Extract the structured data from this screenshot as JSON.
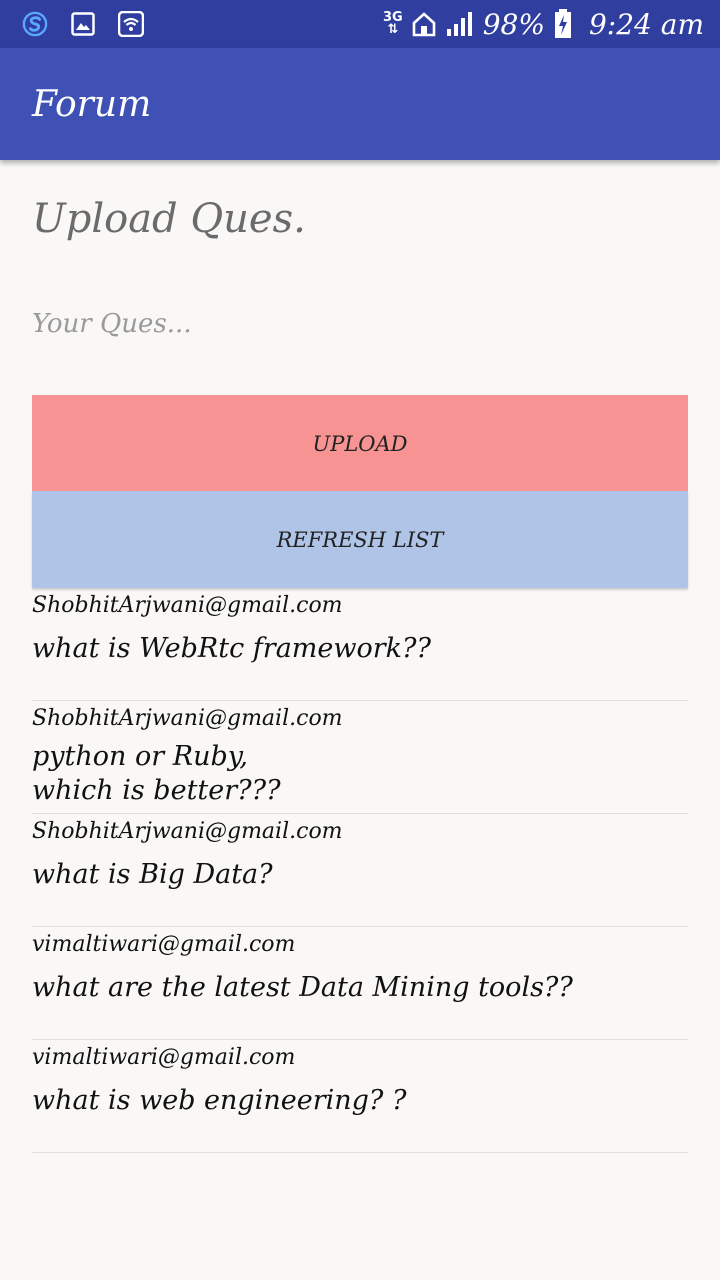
{
  "status_bar": {
    "icons": [
      "s-app-icon",
      "image-icon",
      "wifi-icon",
      "home-icon",
      "signal-icon",
      "battery-charging-icon"
    ],
    "network_top": "3G",
    "network_bottom": "⇅",
    "battery": "98%",
    "time": "9:24 am"
  },
  "app_bar": {
    "title": "Forum"
  },
  "upload": {
    "title": "Upload Ques.",
    "placeholder": "Your Ques...",
    "upload_label": "UPLOAD",
    "refresh_label": "REFRESH LIST"
  },
  "colors": {
    "status_bar": "#303f9f",
    "app_bar": "#3f51b5",
    "upload_button": "#f79392",
    "refresh_button": "#b0c4e8"
  },
  "questions": [
    {
      "email": "ShobhitArjwani@gmail.com",
      "question": "what is WebRtc framework??"
    },
    {
      "email": "ShobhitArjwani@gmail.com",
      "question": "python or Ruby,\nwhich is better???"
    },
    {
      "email": "ShobhitArjwani@gmail.com",
      "question": "what is Big Data?"
    },
    {
      "email": "vimaltiwari@gmail.com",
      "question": "what are the latest  Data Mining tools??"
    },
    {
      "email": "vimaltiwari@gmail.com",
      "question": "what is web engineering? ?"
    }
  ]
}
